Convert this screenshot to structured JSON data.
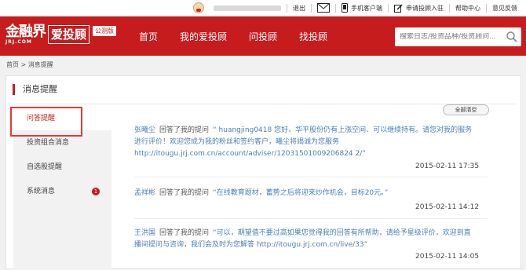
{
  "topbar": {
    "logout": "退出",
    "mobile": "手机客户端",
    "apply": "申请投顾入驻",
    "help": "帮助中心",
    "feedback": "意见反馈"
  },
  "brand": {
    "logo_big": "金融界",
    "logo_small": "JRJ.COM",
    "product": "爱投顾",
    "badge": "公测版"
  },
  "nav": [
    "首页",
    "我的爱投顾",
    "问投顾",
    "找投顾"
  ],
  "search": {
    "placeholder": "搜索日志/投资品种/投资顾问..."
  },
  "breadcrumb": "首页 > 消息提醒",
  "page_title": "消息提醒",
  "sidebar": {
    "items": [
      {
        "label": "问答提醒"
      },
      {
        "label": "投资组合消息"
      },
      {
        "label": "自选股提醒"
      },
      {
        "label": "系统消息",
        "count": "1"
      }
    ]
  },
  "clear_all": "全部清空",
  "messages": [
    {
      "who": "张曦尘",
      "verb": "回答了我的提问",
      "text": "“ huangjing0418 您好、华平股份仍有上涨空间、可以继续持有。请您对我的服务进行评价！欢迎您成为我的粉丝和签约客户，曦尘将竭诚为您服务 http://itougu.jrj.com.cn/account/adviser/12031501009206824 2/”",
      "time": "2015-02-11 17:35"
    },
    {
      "who": "孟祥彬",
      "verb": "回答了我的提问",
      "text": "“在线教育题材，蓄势之后将迎来炒作机会，目标20元。”",
      "time": "2015-02-11 14:12"
    },
    {
      "who": "王洪国",
      "verb": "回答了我的提问",
      "text": "“可以，期望值不要过高如果您觉得我的回答有所帮助，请给予星级评价，欢迎到直播间提问与咨询，我们会及时为您解答 http://itougu.jrj.com.cn/live/33”",
      "time": "2015-02-11 14:05"
    }
  ]
}
